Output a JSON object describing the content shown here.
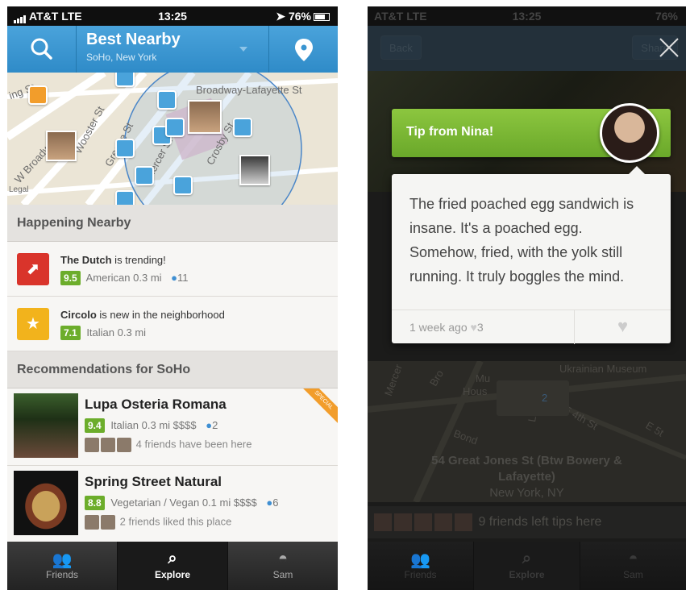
{
  "status_left": {
    "carrier": "AT&T",
    "network": "LTE",
    "time": "13:25",
    "battery": "76%"
  },
  "status_right": {
    "carrier": "AT&T",
    "network": "LTE",
    "time": "13:25",
    "battery": "76%"
  },
  "header": {
    "title": "Best Nearby",
    "subtitle": "SoHo, New York"
  },
  "map": {
    "labels": [
      "Broadway-Lafayette St",
      "Wooster St",
      "Greene St",
      "Mercer St",
      "Crosby St",
      "W Broadway",
      "Legal",
      "ing St"
    ]
  },
  "happening": {
    "title": "Happening Nearby",
    "items": [
      {
        "name": "The Dutch",
        "text": " is trending!",
        "score": "9.5",
        "category": "American",
        "distance": "0.3 mi",
        "people": "11",
        "icon": "trending-icon",
        "color": "#d9342b"
      },
      {
        "name": "Circolo",
        "text": " is new in the neighborhood",
        "score": "7.1",
        "category": "Italian",
        "distance": "0.3 mi",
        "icon": "star-icon",
        "color": "#f2b31c"
      }
    ]
  },
  "recommendations": {
    "title": "Recommendations for SoHo",
    "items": [
      {
        "name": "Lupa Osteria Romana",
        "score": "9.4",
        "category": "Italian",
        "distance": "0.3 mi",
        "price": "$$$$",
        "people": "2",
        "friends": "4 friends have been here",
        "badge": "SPECIAL"
      },
      {
        "name": "Spring Street Natural",
        "score": "8.8",
        "category": "Vegetarian / Vegan",
        "distance": "0.1 mi",
        "price": "$$$$",
        "people": "6",
        "friends": "2 friends liked this place"
      }
    ]
  },
  "tabs": [
    {
      "label": "Friends",
      "icon": "friends-icon"
    },
    {
      "label": "Explore",
      "icon": "search-icon"
    },
    {
      "label": "Sam",
      "icon": "avatar-icon"
    }
  ],
  "right": {
    "back": "Back",
    "share": "Share",
    "tip_banner": "Tip from Nina!",
    "tip_text": "The fried poached egg sandwich is insane. It's a poached egg. Somehow, fried, with the yolk still running. It truly boggles the mind.",
    "tip_age": "1 week ago",
    "tip_likes": "3",
    "address_line1": "54 Great Jones St (Btw Bowery &",
    "address_line2": "Lafayette)",
    "city": "New York, NY",
    "friends_tips": "9 friends left tips here",
    "map_labels": [
      "Ukrainian Museum",
      "E 4th St",
      "E 5t",
      "Bond",
      "Mercer",
      "Bro",
      "Mu",
      "Hous",
      "Lafa"
    ],
    "map_badge": "2"
  },
  "colors": {
    "accent_blue": "#2f8bc8",
    "score_green": "#6cad2b",
    "tip_green": "#7cb83a"
  }
}
